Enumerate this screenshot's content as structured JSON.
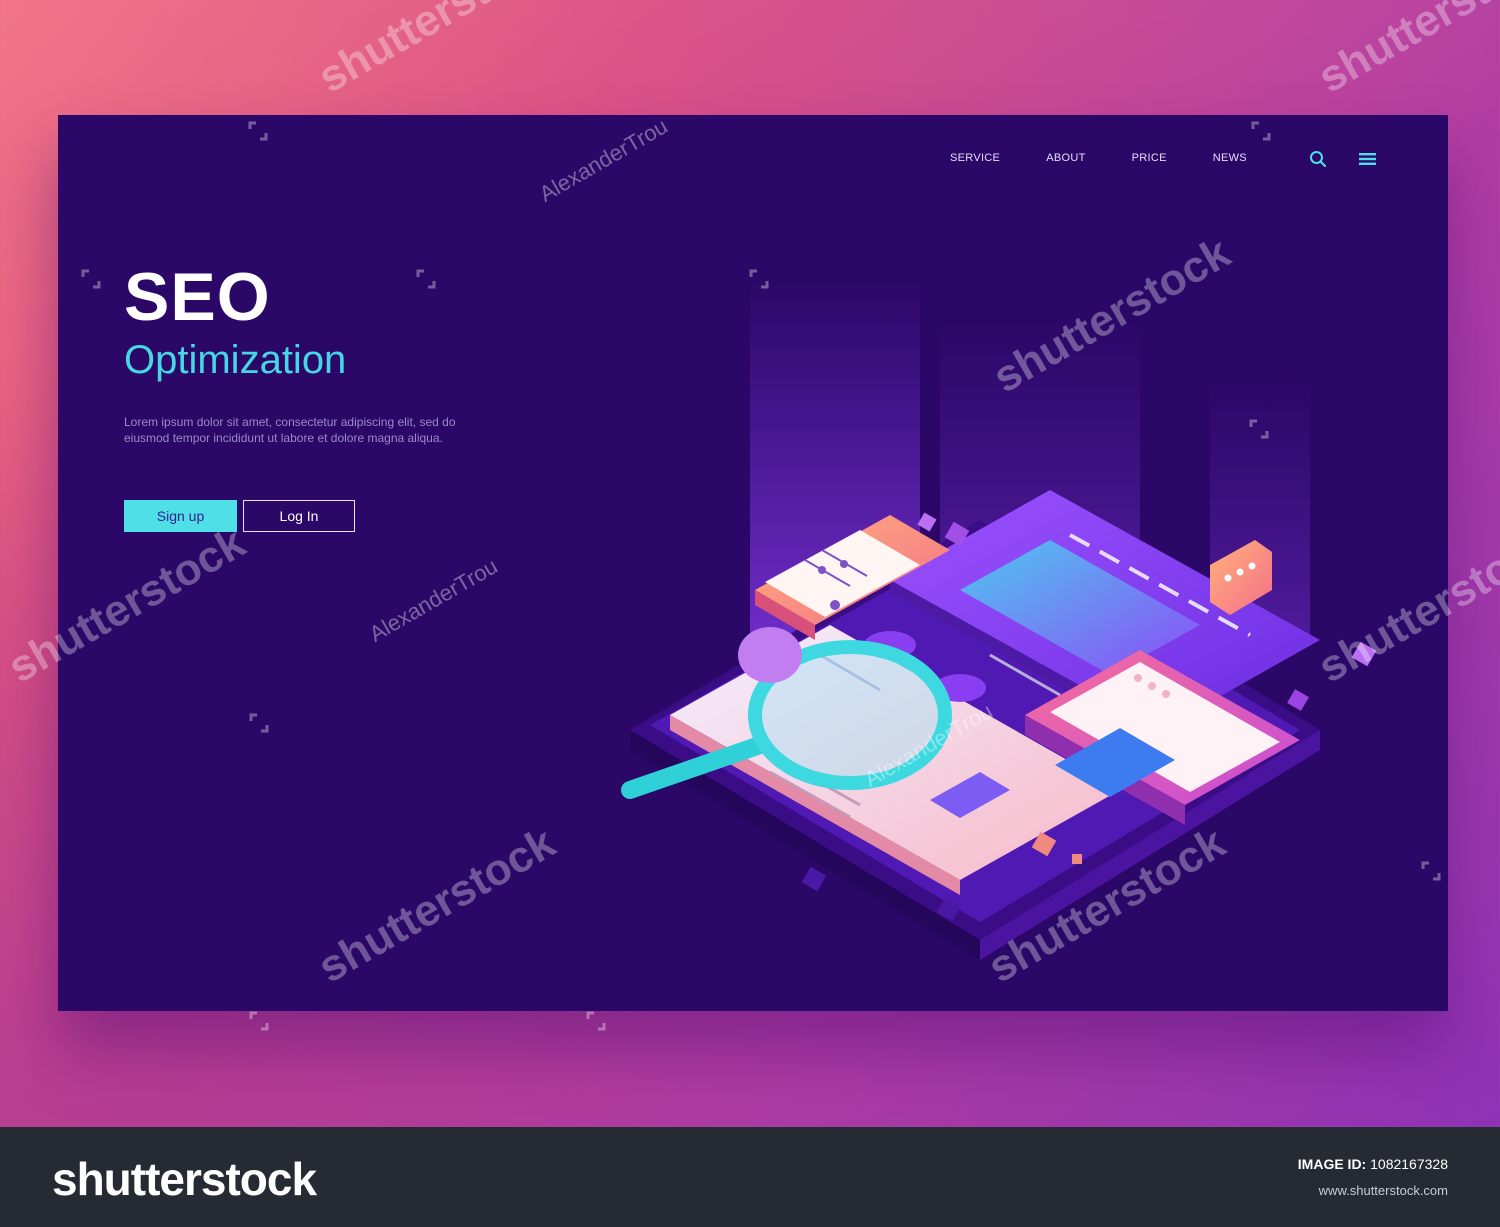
{
  "nav": {
    "items": [
      "SERVICE",
      "ABOUT",
      "PRICE",
      "NEWS"
    ]
  },
  "icons": {
    "search": "search-icon",
    "menu": "hamburger-menu-icon"
  },
  "hero": {
    "title": "SEO",
    "subtitle": "Optimization",
    "description": "Lorem ipsum dolor sit amet, consectetur adipiscing elit, sed do eiusmod tempor incididunt ut labore et dolore magna aliqua.",
    "signup_label": "Sign up",
    "login_label": "Log In"
  },
  "watermark": {
    "brand": "shutterstock",
    "author": "AlexanderTrou"
  },
  "footer": {
    "logo": "shutterstock",
    "id_label": "IMAGE ID:",
    "id_value": "1082167328",
    "url": "www.shutterstock.com"
  },
  "colors": {
    "card_bg": "#2b0767",
    "accent_cyan": "#4fdfe6",
    "subtitle_cyan": "#46d7e4",
    "footer_bg": "#252a33"
  }
}
